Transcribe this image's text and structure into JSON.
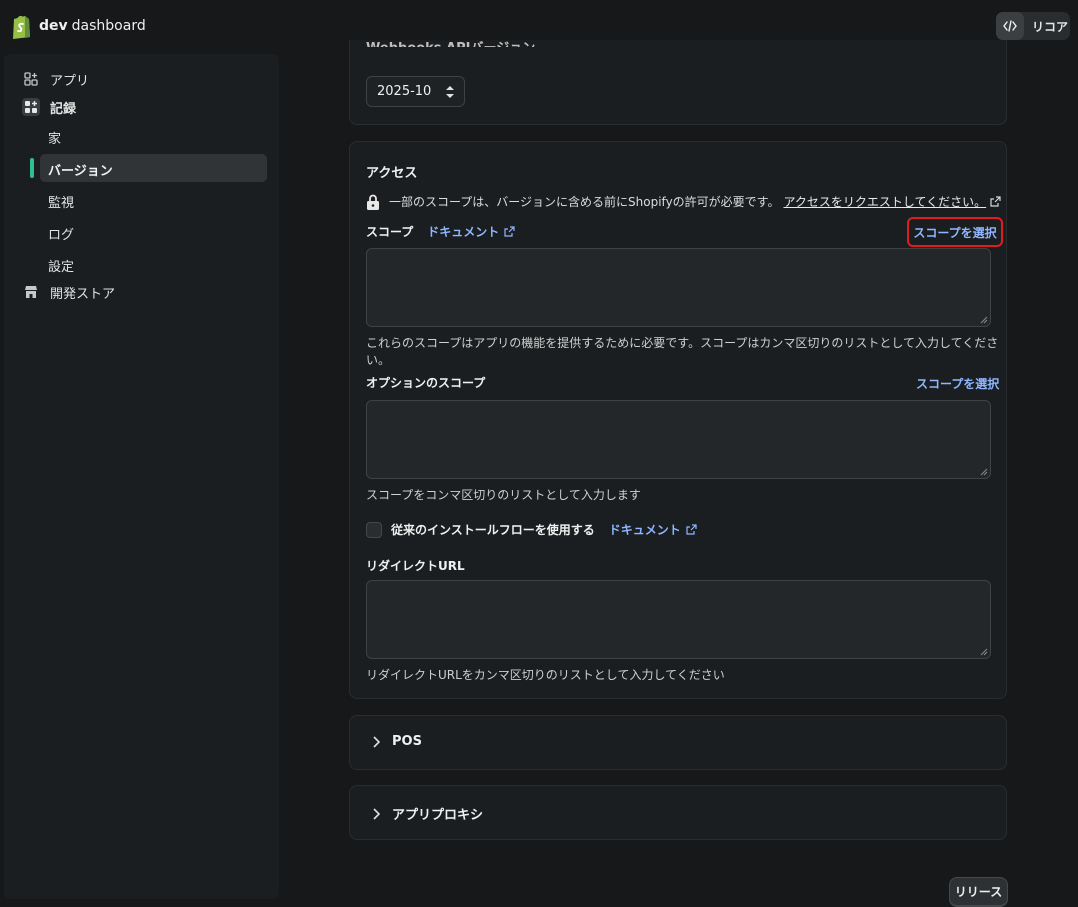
{
  "header": {
    "brand_bold": "dev",
    "brand_rest": "dashboard",
    "code_button_label": "リコア"
  },
  "sidebar": {
    "items": [
      {
        "label": "アプリ",
        "icon": "apps-icon"
      },
      {
        "label": "記録",
        "icon": "apps-icon"
      },
      {
        "label": "開発ストア",
        "icon": "store-icon"
      }
    ],
    "subitems": [
      {
        "label": "家"
      },
      {
        "label": "バージョン"
      },
      {
        "label": "監視"
      },
      {
        "label": "ログ"
      },
      {
        "label": "設定"
      }
    ]
  },
  "webhooks": {
    "heading_partial": "Webhooks APIバージョン",
    "version_value": "2025-10"
  },
  "access": {
    "heading": "アクセス",
    "notice_text": "一部のスコープは、バージョンに含める前にShopifyの許可が必要です。",
    "notice_link": "アクセスをリクエストしてください。",
    "scopes_label": "スコープ",
    "docs_label": "ドキュメント",
    "select_scopes": "スコープを選択",
    "scopes_help": "これらのスコープはアプリの機能を提供するために必要です。スコープはカンマ区切りのリストとして入力してください。",
    "optional_label": "オプションのスコープ",
    "optional_select": "スコープを選択",
    "optional_help": "スコープをコンマ区切りのリストとして入力します",
    "legacy_label": "従来のインストールフローを使用する",
    "legacy_docs": "ドキュメント",
    "redirect_label": "リダイレクトURL",
    "redirect_help": "リダイレクトURLをカンマ区切りのリストとして入力してください"
  },
  "sections": {
    "pos": "POS",
    "proxy": "アプリプロキシ"
  },
  "footer": {
    "release_button": "リリース"
  },
  "colors": {
    "accent_green": "#2fbf8f",
    "link_blue": "#8fb6ff",
    "highlight_red": "#e01c1c"
  }
}
